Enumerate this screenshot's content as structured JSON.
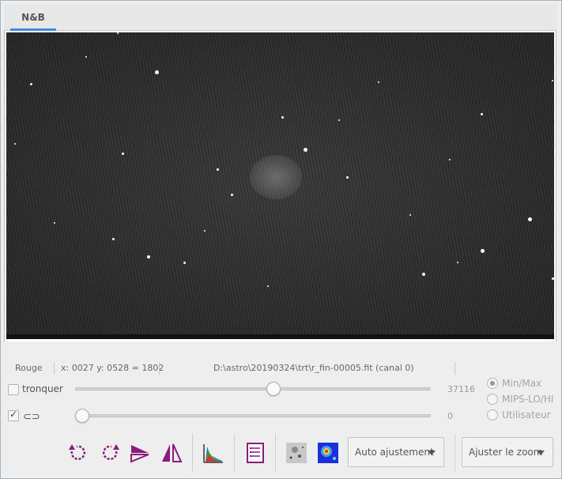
{
  "tab": {
    "label": "N&B"
  },
  "status": {
    "channel": "Rouge",
    "coords": "x: 0027 y: 0528 = 1802",
    "file": "D:\\astro\\20190324\\trt\\r_fin-00005.fit (canal 0)"
  },
  "controls": {
    "crop_label": "tronquer",
    "crop_checked": false,
    "link_checked": true,
    "high_slider_value": "37116",
    "high_slider_fraction": 0.56,
    "low_slider_value": "0",
    "low_slider_fraction": 0.0
  },
  "scale_modes": {
    "options": [
      "Min/Max",
      "MIPS-LO/HI",
      "Utilisateur"
    ],
    "selected": "Min/Max"
  },
  "toolbar": {
    "auto_adjust_label": "Auto ajustement",
    "zoom_label": "Ajuster le zoom",
    "icons": [
      "rotate-left-icon",
      "rotate-right-icon",
      "flip-horizontal-icon",
      "mirror-vertical-icon",
      "histogram-icon",
      "fits-header-icon",
      "negative-view-icon",
      "false-color-icon"
    ]
  },
  "colors": {
    "accent": "#3d8ee0",
    "icon_purple": "#8b1a7e"
  }
}
